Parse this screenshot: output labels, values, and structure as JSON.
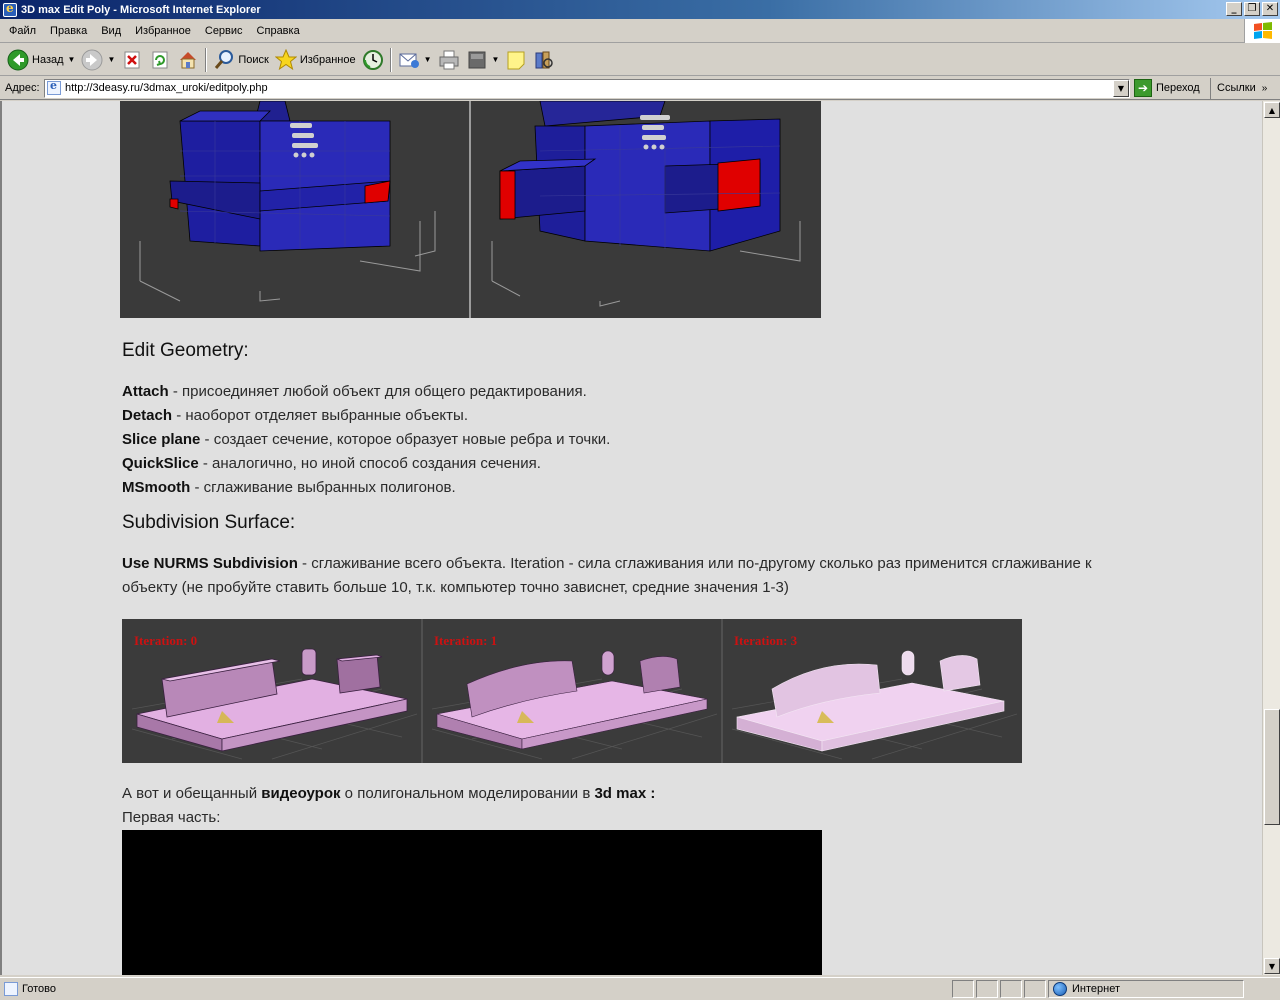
{
  "window": {
    "title": "3D max Edit Poly - Microsoft Internet Explorer",
    "controls": [
      "_",
      "❐",
      "✕"
    ]
  },
  "menu": [
    "Файл",
    "Правка",
    "Вид",
    "Избранное",
    "Сервис",
    "Справка"
  ],
  "toolbar": {
    "back": "Назад",
    "search": "Поиск",
    "favorites": "Избранное"
  },
  "address": {
    "label": "Адрес:",
    "url": "http://3deasy.ru/3dmax_uroki/editpoly.php",
    "go": "Переход",
    "links": "Ссылки"
  },
  "content": {
    "heading_edit_geometry": "Edit Geometry:",
    "attach_term": "Attach",
    "attach_desc": " - присоединяет любой объект для общего редактирования.",
    "detach_term": "Detach",
    "detach_desc": " - наоборот отделяет выбранные объекты.",
    "slice_term": "Slice plane",
    "slice_desc": " - создает сечение, которое образует новые ребра и точки.",
    "quickslice_term": "QuickSlice",
    "quickslice_desc": " - аналогично, но иной способ создания сечения.",
    "msmooth_term": "MSmooth",
    "msmooth_desc": " - сглаживание выбранных полигонов.",
    "heading_subdivision": "Subdivision Surface:",
    "nurms_term": "Use NURMS Subdivision",
    "nurms_desc": " - сглаживание всего объекта. Iteration - сила сглаживания или по-другому сколько раз применится сглаживание к объекту (не пробуйте ставить больше 10, т.к. компьютер точно зависнет, средние значения 1-3)",
    "iteration_labels": [
      "Iteration: 0",
      "Iteration: 1",
      "Iteration: 3"
    ],
    "video_intro_a": "А вот и обещанный ",
    "video_intro_b": "видеоурок",
    "video_intro_c": " о полигональном моделировании в ",
    "video_intro_d": "3d max :",
    "first_part": "Первая часть:"
  },
  "status": {
    "text": "Готово",
    "zone": "Интернет"
  },
  "colors": {
    "viewport_bg": "#e0e0e0",
    "model_blue": "#2828a8",
    "model_red": "#e00000",
    "iteration_red": "#cc1111",
    "sofa_pink": "#d9a6d9"
  }
}
